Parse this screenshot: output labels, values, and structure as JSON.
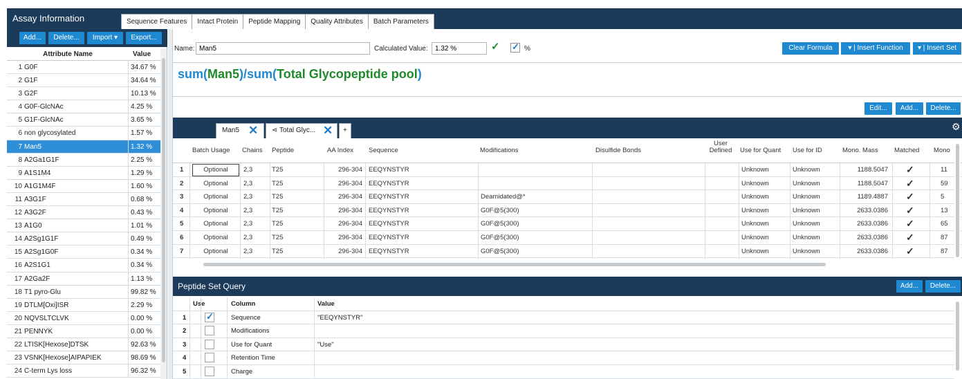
{
  "header": {
    "title": "Assay Information",
    "tabs": [
      "Sequence Features",
      "Intact Protein",
      "Peptide Mapping",
      "Quality Attributes",
      "Batch Parameters"
    ],
    "active_tab": "Quality Attributes"
  },
  "left_toolbar": {
    "add": "Add...",
    "delete": "Delete...",
    "import": "Import",
    "export": "Export..."
  },
  "attributes": {
    "col_name": "Attribute Name",
    "col_value": "Value",
    "selected": "Man5",
    "rows": [
      {
        "n": "1",
        "name": "G0F",
        "value": "34.67 %"
      },
      {
        "n": "2",
        "name": "G1F",
        "value": "34.64 %"
      },
      {
        "n": "3",
        "name": "G2F",
        "value": "10.13 %"
      },
      {
        "n": "4",
        "name": "G0F-GlcNAc",
        "value": "4.25 %"
      },
      {
        "n": "5",
        "name": "G1F-GlcNAc",
        "value": "3.65 %"
      },
      {
        "n": "6",
        "name": "non glycosylated",
        "value": "1.57 %"
      },
      {
        "n": "7",
        "name": "Man5",
        "value": "1.32 %"
      },
      {
        "n": "8",
        "name": "A2Ga1G1F",
        "value": "2.25 %"
      },
      {
        "n": "9",
        "name": "A1S1M4",
        "value": "1.29 %"
      },
      {
        "n": "10",
        "name": "A1G1M4F",
        "value": "1.60 %"
      },
      {
        "n": "11",
        "name": "A3G1F",
        "value": "0.68 %"
      },
      {
        "n": "12",
        "name": "A3G2F",
        "value": "0.43 %"
      },
      {
        "n": "13",
        "name": "A1G0",
        "value": "1.01 %"
      },
      {
        "n": "14",
        "name": "A2Sg1G1F",
        "value": "0.49 %"
      },
      {
        "n": "15",
        "name": "A2Sg1G0F",
        "value": "0.34 %"
      },
      {
        "n": "16",
        "name": "A2S1G1",
        "value": "0.34 %"
      },
      {
        "n": "17",
        "name": "A2Ga2F",
        "value": "1.13 %"
      },
      {
        "n": "18",
        "name": "T1 pyro-Glu",
        "value": "99.82 %"
      },
      {
        "n": "19",
        "name": "DTLM[Oxi]ISR",
        "value": "2.29 %"
      },
      {
        "n": "20",
        "name": "NQVSLTCLVK",
        "value": "0.00 %"
      },
      {
        "n": "21",
        "name": "PENNYK",
        "value": "0.00 %"
      },
      {
        "n": "22",
        "name": "LTISK[Hexose]DTSK",
        "value": "92.63 %"
      },
      {
        "n": "23",
        "name": "VSNK[Hexose]AIPAPIEK",
        "value": "98.69 %"
      },
      {
        "n": "24",
        "name": "C-term Lys loss",
        "value": "96.32 %"
      }
    ]
  },
  "formula_bar": {
    "name_label": "Name:",
    "name_value": "Man5",
    "calc_label": "Calculated Value:",
    "calc_value": "1.32 %",
    "percent_label": "%",
    "clear_formula": "Clear Formula",
    "insert_function": "Insert Function",
    "insert_set": "Insert Set",
    "formula_parts": [
      "sum",
      "(",
      "Man5",
      ")/",
      "sum",
      "(",
      "Total Glycopeptide pool",
      ")"
    ],
    "edit": "Edit...",
    "add": "Add...",
    "delete": "Delete..."
  },
  "peptide_tabs": {
    "tab1": "Man5",
    "tab2": "Total Glyc...",
    "plus": "+"
  },
  "peptide_grid": {
    "headers": [
      "Batch Usage",
      "Chains",
      "Peptide",
      "AA Index",
      "Sequence",
      "Modifications",
      "Disulfide Bonds",
      "User Defined",
      "Use for Quant",
      "Use for ID",
      "Mono. Mass",
      "Matched",
      "Mono"
    ],
    "rows": [
      {
        "n": "1",
        "usage": "Optional",
        "chains": "2,3",
        "peptide": "T25",
        "aa": "296-304",
        "seq": "EEQYNSTYR",
        "mod": "",
        "quant": "Unknown",
        "id": "Unknown",
        "mass": "1188.5047",
        "mono": "11"
      },
      {
        "n": "2",
        "usage": "Optional",
        "chains": "2,3",
        "peptide": "T25",
        "aa": "296-304",
        "seq": "EEQYNSTYR",
        "mod": "",
        "quant": "Unknown",
        "id": "Unknown",
        "mass": "1188.5047",
        "mono": "59"
      },
      {
        "n": "3",
        "usage": "Optional",
        "chains": "2,3",
        "peptide": "T25",
        "aa": "296-304",
        "seq": "EEQYNSTYR",
        "mod": "Deamidated@*",
        "quant": "Unknown",
        "id": "Unknown",
        "mass": "1189.4887",
        "mono": "5"
      },
      {
        "n": "4",
        "usage": "Optional",
        "chains": "2,3",
        "peptide": "T25",
        "aa": "296-304",
        "seq": "EEQYNSTYR",
        "mod": "G0F@5(300)",
        "quant": "Unknown",
        "id": "Unknown",
        "mass": "2633.0386",
        "mono": "13"
      },
      {
        "n": "5",
        "usage": "Optional",
        "chains": "2,3",
        "peptide": "T25",
        "aa": "296-304",
        "seq": "EEQYNSTYR",
        "mod": "G0F@5(300)",
        "quant": "Unknown",
        "id": "Unknown",
        "mass": "2633.0386",
        "mono": "65"
      },
      {
        "n": "6",
        "usage": "Optional",
        "chains": "2,3",
        "peptide": "T25",
        "aa": "296-304",
        "seq": "EEQYNSTYR",
        "mod": "G0F@5(300)",
        "quant": "Unknown",
        "id": "Unknown",
        "mass": "2633.0386",
        "mono": "87"
      },
      {
        "n": "7",
        "usage": "Optional",
        "chains": "2,3",
        "peptide": "T25",
        "aa": "296-304",
        "seq": "EEQYNSTYR",
        "mod": "G0F@5(300)",
        "quant": "Unknown",
        "id": "Unknown",
        "mass": "2633.0386",
        "mono": "87"
      }
    ]
  },
  "query": {
    "title": "Peptide Set Query",
    "add": "Add...",
    "delete": "Delete...",
    "col_use": "Use",
    "col_column": "Column",
    "col_value": "Value",
    "rows": [
      {
        "n": "1",
        "checked": true,
        "column": "Sequence",
        "value": "\"EEQYNSTYR\""
      },
      {
        "n": "2",
        "checked": false,
        "column": "Modifications",
        "value": ""
      },
      {
        "n": "3",
        "checked": false,
        "column": "Use for Quant",
        "value": "\"Use\""
      },
      {
        "n": "4",
        "checked": false,
        "column": "Retention Time",
        "value": ""
      },
      {
        "n": "5",
        "checked": false,
        "column": "Charge",
        "value": ""
      }
    ]
  },
  "colors": {
    "header_bg": "#1c3a5a",
    "button": "#1e88d0",
    "selected_row": "#2e8fd6",
    "check_green": "#1f8a2a"
  }
}
